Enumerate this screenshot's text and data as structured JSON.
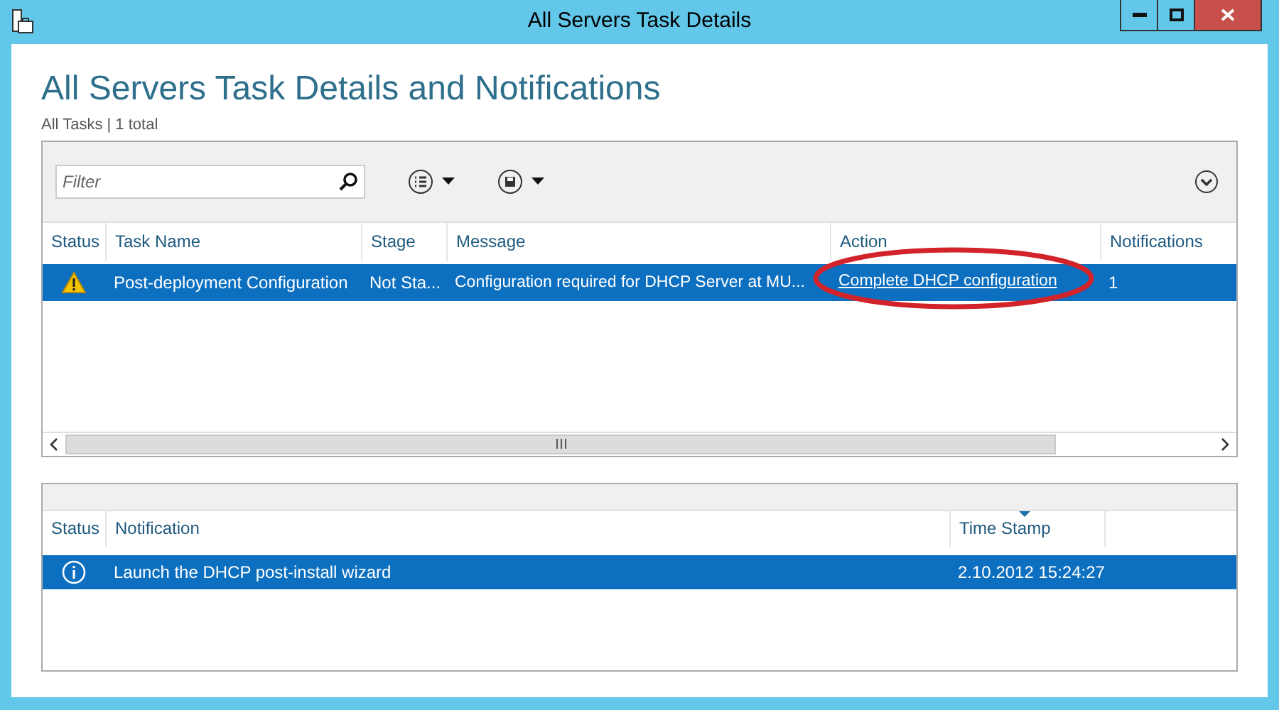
{
  "window": {
    "title": "All Servers Task Details"
  },
  "heading": "All Servers Task Details and Notifications",
  "subtitle": "All Tasks | 1 total",
  "filter": {
    "placeholder": "Filter"
  },
  "tasks": {
    "columns": [
      {
        "label": "Status"
      },
      {
        "label": "Task Name"
      },
      {
        "label": "Stage"
      },
      {
        "label": "Message"
      },
      {
        "label": "Action"
      },
      {
        "label": "Notifications"
      }
    ],
    "rows": [
      {
        "selected": true,
        "kind": "warning",
        "task_name": "Post-deployment Configuration",
        "stage": "Not Sta...",
        "message": "Configuration required for DHCP Server at MU...",
        "action": "Complete DHCP configuration",
        "notifications": "1",
        "highlighted": true
      }
    ]
  },
  "notifications": {
    "columns": [
      {
        "label": "Status",
        "sorted": false
      },
      {
        "label": "Notification",
        "sorted": false
      },
      {
        "label": "Time Stamp",
        "sorted": true
      }
    ],
    "rows": [
      {
        "selected": true,
        "kind": "info",
        "notification": "Launch the DHCP post-install wizard",
        "time_stamp": "2.10.2012 15:24:27"
      }
    ]
  }
}
